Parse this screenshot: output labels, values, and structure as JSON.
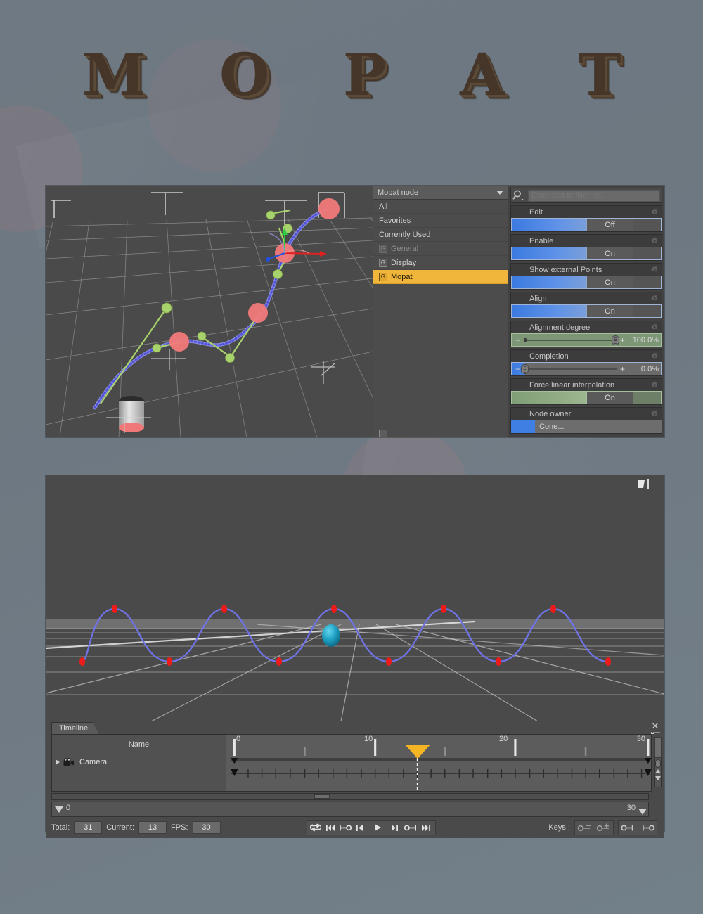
{
  "title": {
    "text": "M O P A T",
    "color": "#453629"
  },
  "top_panel": {
    "node_list": {
      "header_label": "Mopat node",
      "header_caret_icon": "chevron-down-icon",
      "items": [
        {
          "label": "All",
          "icon": null,
          "state": "normal",
          "badge": null
        },
        {
          "label": "Favorites",
          "icon": null,
          "state": "normal",
          "badge": null
        },
        {
          "label": "Currently Used",
          "icon": null,
          "state": "normal",
          "badge": null
        },
        {
          "label": "General",
          "icon": "group-badge-icon",
          "state": "disabled",
          "badge": "G"
        },
        {
          "label": "Display",
          "icon": "group-badge-icon",
          "state": "normal",
          "badge": "G"
        },
        {
          "label": "Mopat",
          "icon": "group-badge-icon",
          "state": "selected",
          "badge": "G"
        }
      ],
      "selected_highlight_color": "#f0b63c",
      "cutoff_label": ""
    },
    "attributes": {
      "filter_placeholder": "Enter text to filter by...",
      "filter_value": "",
      "search_icon": "magnifier-icon",
      "rows": [
        {
          "label": "Edit",
          "kind": "toggle",
          "value": "Off",
          "fill": "blue"
        },
        {
          "label": "Enable",
          "kind": "toggle",
          "value": "On",
          "fill": "blue"
        },
        {
          "label": "Show external Points",
          "kind": "toggle",
          "value": "On",
          "fill": "blue"
        },
        {
          "label": "Align",
          "kind": "toggle",
          "value": "On",
          "fill": "blue"
        },
        {
          "label": "Alignment degree",
          "kind": "slider",
          "value": "100.0%",
          "percent": 100,
          "fill": "green"
        },
        {
          "label": "Completion",
          "kind": "slider",
          "value": "0.0%",
          "percent": 0,
          "fill": "blue"
        },
        {
          "label": "Force linear interpolation",
          "kind": "toggle",
          "value": "On",
          "fill": "green"
        },
        {
          "label": "Node owner",
          "kind": "owner",
          "value": "Cone...",
          "swatch": "#3f7ee2"
        }
      ],
      "minus_glyph": "−",
      "plus_glyph": "+",
      "gear_icon": "gear-icon"
    }
  },
  "bottom_panel": {
    "timeline": {
      "tab_label": "Timeline",
      "close_icon": "close-icon",
      "menu_icon": "timeline-menu-icon",
      "name_column_header": "Name",
      "tracks": [
        {
          "label": "Camera",
          "icon": "camera-icon",
          "expander": "triangle-right-icon"
        }
      ],
      "ruler_labels": [
        "0",
        "10",
        "20",
        "30"
      ],
      "ruler_min": 0,
      "ruler_max": 30,
      "playhead_frame": 13,
      "range_start_label": "0",
      "range_end_label": "30",
      "footer": {
        "total_label": "Total:",
        "total_value": "31",
        "current_label": "Current:",
        "current_value": "13",
        "fps_label": "FPS:",
        "fps_value": "30",
        "keys_label": "Keys :",
        "transport_buttons": [
          "loop-icon",
          "go-to-start-icon",
          "prev-key-icon",
          "prev-frame-icon",
          "play-icon",
          "next-frame-icon",
          "next-key-icon",
          "go-to-end-icon"
        ],
        "key_buttons": [
          "remove-key-icon",
          "add-key-icon",
          "key-left-icon",
          "key-right-icon"
        ]
      }
    }
  },
  "viewports": {
    "top": {
      "name": "3d-motion-path-viewport",
      "path_color": "#6f73e8",
      "keypoint_color": "#f07878",
      "handle_color": "#a6d36a",
      "grid_color": "#a8a8a8",
      "background": "#4a4a4a"
    },
    "bottom": {
      "name": "3d-sine-path-viewport",
      "path_color": "#6f73e8",
      "keypoint_color": "#ee2222",
      "object_color": "#1aa0c0",
      "grid_color": "#cfcfcf",
      "background": "#4a4a4a"
    }
  }
}
